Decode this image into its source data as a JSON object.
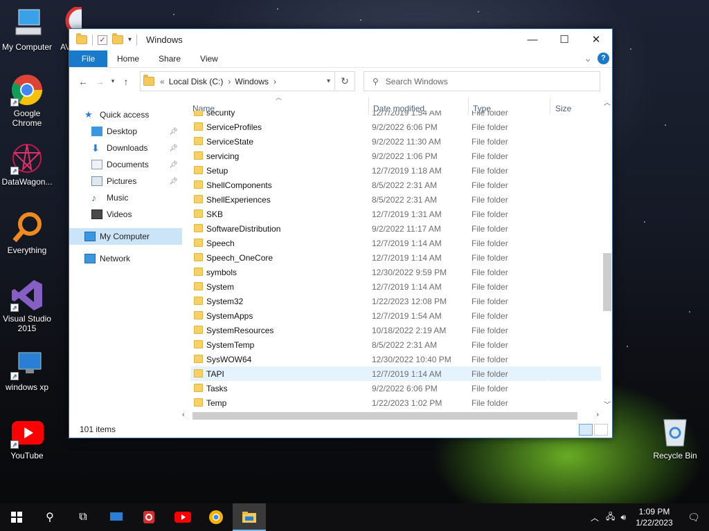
{
  "desktop": {
    "icons": [
      {
        "label": "My Computer"
      },
      {
        "label": "AV"
      },
      {
        "label": "Google Chrome"
      },
      {
        "label": "DataWagon..."
      },
      {
        "label": "Everything"
      },
      {
        "label": "Visual Studio 2015"
      },
      {
        "label": "windows xp"
      },
      {
        "label": "YouTube"
      },
      {
        "label": "Recycle Bin"
      }
    ]
  },
  "window": {
    "title": "Windows",
    "controls": {
      "minimize": "—",
      "maximize": "☐",
      "close": "✕"
    }
  },
  "ribbon": {
    "tabs": [
      "File",
      "Home",
      "Share",
      "View"
    ],
    "expand_glyph": "⌄",
    "help_glyph": "?"
  },
  "address": {
    "overflow": "«",
    "crumbs": [
      "Local Disk (C:)",
      "Windows"
    ],
    "search_placeholder": "Search Windows"
  },
  "nav": {
    "items": [
      {
        "label": "Quick access"
      },
      {
        "label": "Desktop"
      },
      {
        "label": "Downloads"
      },
      {
        "label": "Documents"
      },
      {
        "label": "Pictures"
      },
      {
        "label": "Music"
      },
      {
        "label": "Videos"
      },
      {
        "label": "My Computer"
      },
      {
        "label": "Network"
      }
    ]
  },
  "columns": {
    "name": "Name",
    "date": "Date modified",
    "type": "Type",
    "size": "Size"
  },
  "files": [
    {
      "name": "security",
      "date": "12/7/2019 1:54 AM",
      "type": "File folder"
    },
    {
      "name": "ServiceProfiles",
      "date": "9/2/2022 6:06 PM",
      "type": "File folder"
    },
    {
      "name": "ServiceState",
      "date": "9/2/2022 11:30 AM",
      "type": "File folder"
    },
    {
      "name": "servicing",
      "date": "9/2/2022 1:06 PM",
      "type": "File folder"
    },
    {
      "name": "Setup",
      "date": "12/7/2019 1:18 AM",
      "type": "File folder"
    },
    {
      "name": "ShellComponents",
      "date": "8/5/2022 2:31 AM",
      "type": "File folder"
    },
    {
      "name": "ShellExperiences",
      "date": "8/5/2022 2:31 AM",
      "type": "File folder"
    },
    {
      "name": "SKB",
      "date": "12/7/2019 1:31 AM",
      "type": "File folder"
    },
    {
      "name": "SoftwareDistribution",
      "date": "9/2/2022 11:17 AM",
      "type": "File folder"
    },
    {
      "name": "Speech",
      "date": "12/7/2019 1:14 AM",
      "type": "File folder"
    },
    {
      "name": "Speech_OneCore",
      "date": "12/7/2019 1:14 AM",
      "type": "File folder"
    },
    {
      "name": "symbols",
      "date": "12/30/2022 9:59 PM",
      "type": "File folder"
    },
    {
      "name": "System",
      "date": "12/7/2019 1:14 AM",
      "type": "File folder"
    },
    {
      "name": "System32",
      "date": "1/22/2023 12:08 PM",
      "type": "File folder"
    },
    {
      "name": "SystemApps",
      "date": "12/7/2019 1:54 AM",
      "type": "File folder"
    },
    {
      "name": "SystemResources",
      "date": "10/18/2022 2:19 AM",
      "type": "File folder"
    },
    {
      "name": "SystemTemp",
      "date": "8/5/2022 2:31 AM",
      "type": "File folder"
    },
    {
      "name": "SysWOW64",
      "date": "12/30/2022 10:40 PM",
      "type": "File folder"
    },
    {
      "name": "TAPI",
      "date": "12/7/2019 1:14 AM",
      "type": "File folder",
      "selected": true
    },
    {
      "name": "Tasks",
      "date": "9/2/2022 6:06 PM",
      "type": "File folder"
    },
    {
      "name": "Temp",
      "date": "1/22/2023 1:02 PM",
      "type": "File folder"
    }
  ],
  "status": {
    "items": "101 items"
  },
  "taskbar": {
    "time": "1:09 PM",
    "date": "1/22/2023"
  }
}
